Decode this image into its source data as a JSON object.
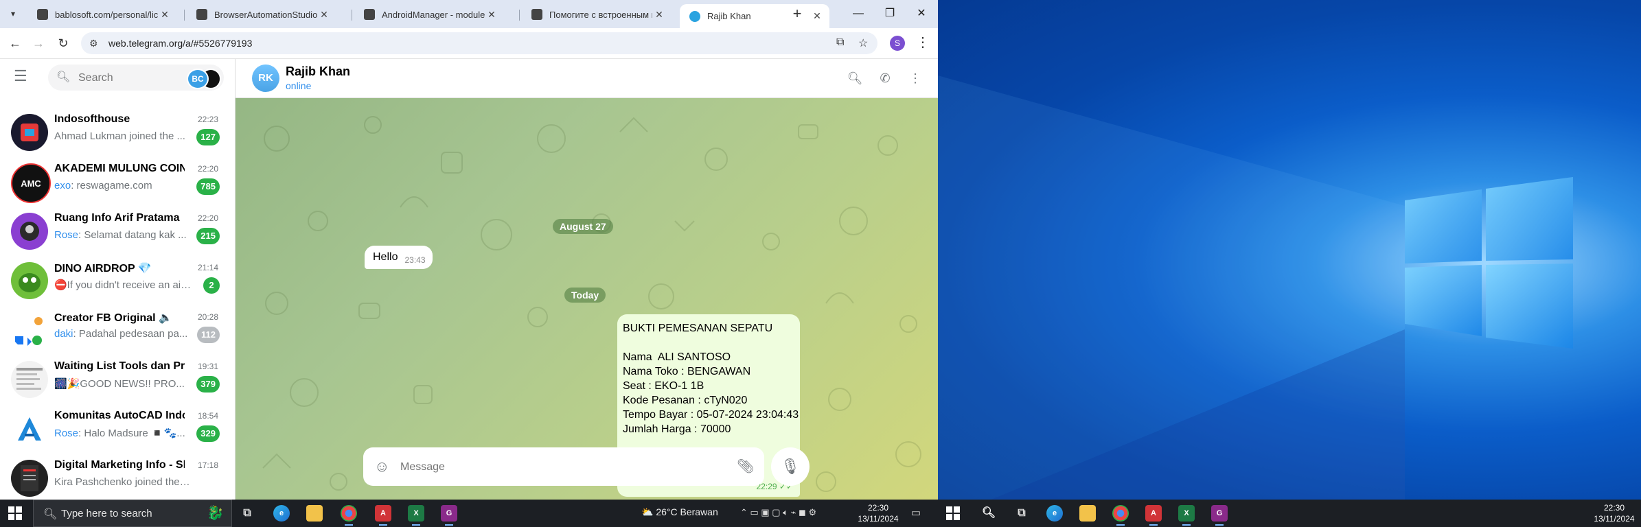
{
  "browser": {
    "tabs": [
      {
        "title": "bablosoft.com/personal/lice",
        "active": false
      },
      {
        "title": "BrowserAutomationStudio |",
        "active": false
      },
      {
        "title": "AndroidManager - module f",
        "active": false
      },
      {
        "title": "Помогите с встроенным п",
        "active": false
      },
      {
        "title": "Rajib Khan",
        "active": true
      }
    ],
    "url": "web.telegram.org/a/#5526779193",
    "profile_initial": "S"
  },
  "sidebar": {
    "search_placeholder": "Search",
    "account_badge": "BC",
    "chats": [
      {
        "name": "Indosofthouse",
        "time": "22:23",
        "sender": "",
        "preview": "Ahmad Lukman joined the ...",
        "unread": "127",
        "muted": false,
        "avatar_color": "#1a1a2e",
        "avatar_text": ""
      },
      {
        "name": "AKADEMI MULUNG COIN",
        "time": "22:20",
        "sender": "exo",
        "preview": ": reswagame.com",
        "unread": "785",
        "muted": false,
        "avatar_color": "#111111",
        "avatar_text": "AMC"
      },
      {
        "name": "Ruang Info Arif Pratama",
        "time": "22:20",
        "sender": "Rose",
        "preview": ": Selamat datang kak ...",
        "unread": "215",
        "muted": false,
        "avatar_color": "#8a3fd1",
        "avatar_text": ""
      },
      {
        "name": "DINO AIRDROP 💎",
        "time": "21:14",
        "sender": "",
        "preview": "⛔If you didn't receive an air...",
        "unread": "2",
        "muted": false,
        "avatar_color": "#6fbf3a",
        "avatar_text": ""
      },
      {
        "name": "Creator FB Original 🔈",
        "time": "20:28",
        "sender": "daki",
        "preview": ": Padahal pedesaan pa...",
        "unread": "112",
        "muted": true,
        "avatar_color": "#ffffff",
        "avatar_text": ""
      },
      {
        "name": "Waiting List Tools dan Pro...",
        "time": "19:31",
        "sender": "",
        "preview": "🎆🎉GOOD NEWS!! PRO...",
        "unread": "379",
        "muted": false,
        "avatar_color": "#f2f2f2",
        "avatar_text": ""
      },
      {
        "name": "Komunitas AutoCAD Indo...",
        "time": "18:54",
        "sender": "Rose",
        "preview": ": Halo Madsure ◾🐾...",
        "unread": "329",
        "muted": false,
        "avatar_color": "#ffffff",
        "avatar_text": ""
      },
      {
        "name": "Digital Marketing Info - Sh...",
        "time": "17:18",
        "sender": "",
        "preview": "Kira Pashchenko joined the group",
        "unread": "",
        "muted": false,
        "avatar_color": "#222222",
        "avatar_text": ""
      }
    ]
  },
  "chat": {
    "peer_initials": "RK",
    "peer_name": "Rajib Khan",
    "peer_status": "online",
    "date_1": "August 27",
    "msg_in": {
      "text": "Hello",
      "time": "23:43"
    },
    "date_2": "Today",
    "msg_out": {
      "lines": [
        "BUKTI PEMESANAN SEPATU",
        "",
        "Nama  ALI SANTOSO",
        "Nama Toko : BENGAWAN",
        "Seat : EKO-1 1B",
        "Kode Pesanan : cTyN020",
        "Tempo Bayar : 05-07-2024 23:04:43",
        "Jumlah Harga : 70000"
      ],
      "time": "22:29"
    },
    "composer_placeholder": "Message"
  },
  "taskbar_left": {
    "search_text": "Type here to search",
    "weather": "26°C  Berawan",
    "time": "22:30",
    "date": "13/11/2024"
  },
  "taskbar_right": {
    "time": "22:30",
    "date": "13/11/2024"
  },
  "colors": {
    "telegram_blue": "#3390ec",
    "unread_green": "#2ab148",
    "outgoing_bubble": "#effdde"
  }
}
